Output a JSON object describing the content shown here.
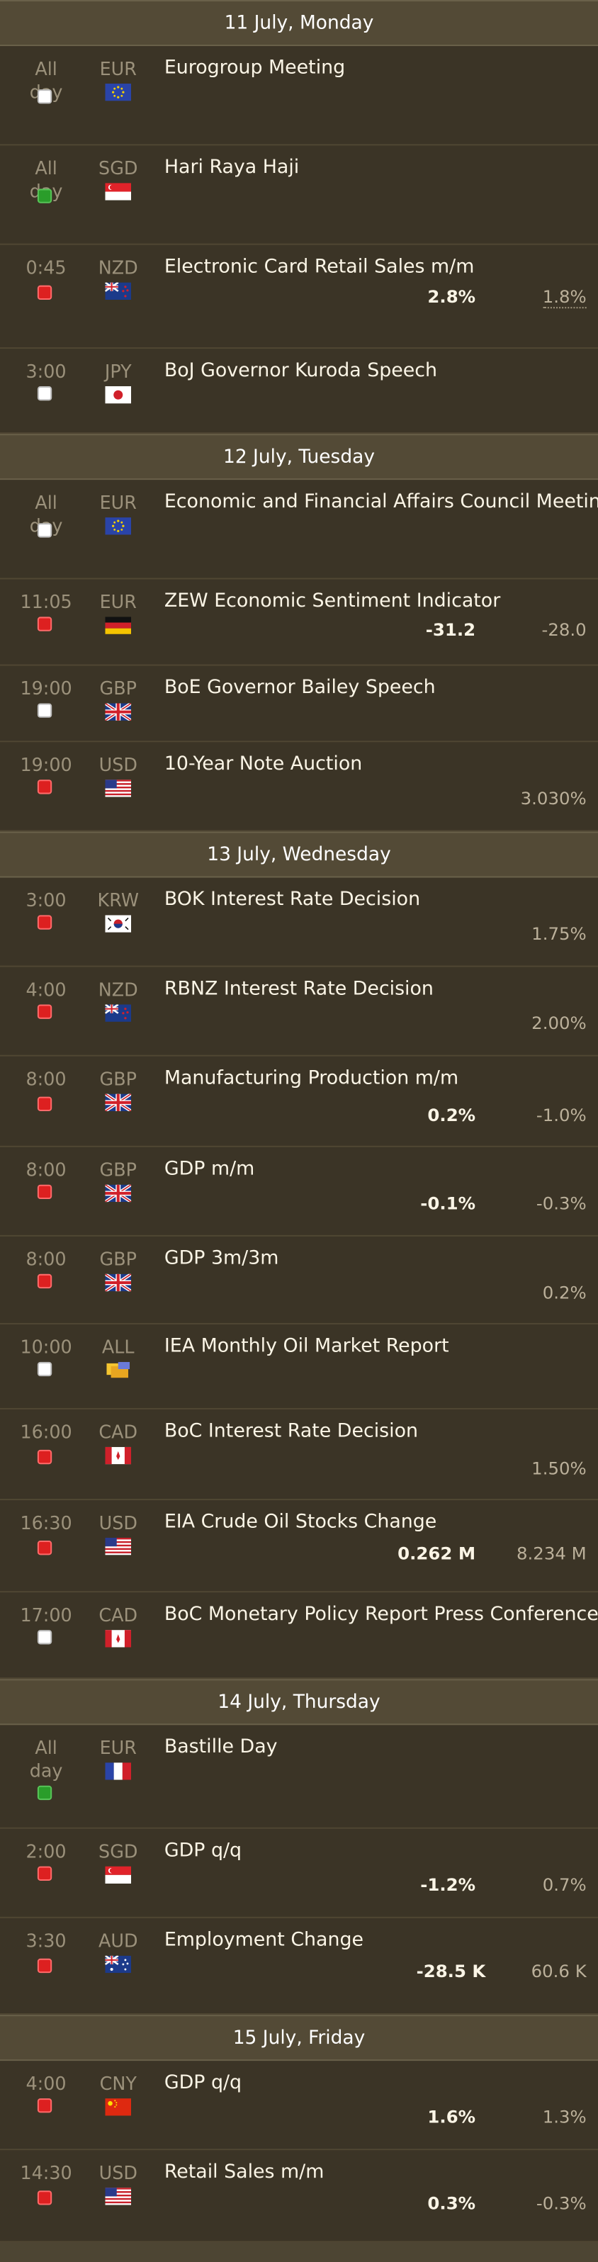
{
  "days": [
    {
      "title": "11 July, Monday",
      "events": [
        {
          "h": 69,
          "time": "All day",
          "cur": "EUR",
          "flag": "eu",
          "title": "Eurogroup Meeting",
          "chk": "w",
          "actual": "",
          "previous": ""
        },
        {
          "h": 69,
          "time": "All day",
          "cur": "SGD",
          "flag": "sg",
          "title": "Hari Raya Haji",
          "chk": "g",
          "actual": "",
          "previous": ""
        },
        {
          "h": 72,
          "time": "0:45",
          "cur": "NZD",
          "flag": "nz",
          "title": "Electronic Card Retail Sales m/m",
          "chk": "r",
          "actual": "2.8%",
          "previous": "1.8%",
          "prevDot": true
        },
        {
          "h": 59,
          "time": "3:00",
          "cur": "JPY",
          "flag": "jp",
          "title": "BoJ Governor Kuroda Speech",
          "chk": "w",
          "actual": "",
          "previous": ""
        }
      ]
    },
    {
      "title": "12 July, Tuesday",
      "events": [
        {
          "h": 69,
          "time": "All day",
          "cur": "EUR",
          "flag": "eu",
          "title": "Economic and Financial Affairs Council Meeting",
          "chk": "w",
          "actual": "",
          "previous": ""
        },
        {
          "h": 60,
          "time": "11:05",
          "cur": "EUR",
          "flag": "de",
          "title": "ZEW Economic Sentiment Indicator",
          "chk": "r",
          "actual": "-31.2",
          "previous": "-28.0"
        },
        {
          "h": 53,
          "time": "19:00",
          "cur": "GBP",
          "flag": "gb",
          "title": "BoE Governor Bailey Speech",
          "chk": "w",
          "actual": "",
          "previous": ""
        },
        {
          "h": 62,
          "time": "19:00",
          "cur": "USD",
          "flag": "us",
          "title": "10-Year Note Auction",
          "chk": "r",
          "actual": "",
          "previous": "3.030%"
        }
      ]
    },
    {
      "title": "13 July, Wednesday",
      "events": [
        {
          "h": 62,
          "time": "3:00",
          "cur": "KRW",
          "flag": "kr",
          "title": "BOK Interest Rate Decision",
          "chk": "r",
          "actual": "",
          "previous": "1.75%"
        },
        {
          "h": 62,
          "time": "4:00",
          "cur": "NZD",
          "flag": "nz",
          "title": "RBNZ Interest Rate Decision",
          "chk": "r",
          "actual": "",
          "previous": "2.00%"
        },
        {
          "h": 63,
          "time": "8:00",
          "cur": "GBP",
          "flag": "gb",
          "title": "Manufacturing Production m/m",
          "chk": "r",
          "actual": "0.2%",
          "previous": "-1.0%"
        },
        {
          "h": 62,
          "time": "8:00",
          "cur": "GBP",
          "flag": "gb",
          "title": "GDP m/m",
          "chk": "r",
          "actual": "-0.1%",
          "previous": "-0.3%"
        },
        {
          "h": 61,
          "time": "8:00",
          "cur": "GBP",
          "flag": "gb",
          "title": "GDP 3m/3m",
          "chk": "r",
          "actual": "",
          "previous": "0.2%"
        },
        {
          "h": 59,
          "time": "10:00",
          "cur": "ALL",
          "flag": "all",
          "title": "IEA Monthly Oil Market Report",
          "chk": "w",
          "actual": "",
          "previous": ""
        },
        {
          "h": 63,
          "time": "16:00",
          "cur": "CAD",
          "flag": "ca",
          "title": "BoC Interest Rate Decision",
          "chk": "r",
          "actual": "",
          "previous": "1.50%"
        },
        {
          "h": 64,
          "time": "16:30",
          "cur": "USD",
          "flag": "us",
          "title": "EIA Crude Oil Stocks Change",
          "chk": "r",
          "actual": "0.262 M",
          "previous": "8.234 M"
        },
        {
          "h": 60,
          "time": "17:00",
          "cur": "CAD",
          "flag": "ca",
          "title": "BoC Monetary Policy Report Press Conference",
          "chk": "w",
          "actual": "",
          "previous": ""
        }
      ]
    },
    {
      "title": "14 July, Thursday",
      "events": [
        {
          "h": 72,
          "time": "All day",
          "cur": "EUR",
          "flag": "fr",
          "title": "Bastille Day",
          "chk": "g",
          "actual": "",
          "previous": ""
        },
        {
          "h": 62,
          "time": "2:00",
          "cur": "SGD",
          "flag": "sg",
          "title": "GDP q/q",
          "chk": "r",
          "actual": "-1.2%",
          "previous": "0.7%"
        },
        {
          "h": 67,
          "time": "3:30",
          "cur": "AUD",
          "flag": "au",
          "title": "Employment Change",
          "chk": "r",
          "actual": "-28.5 K",
          "previous": "60.6 K",
          "actRight": 78
        }
      ]
    },
    {
      "title": "15 July, Friday",
      "events": [
        {
          "h": 62,
          "time": "4:00",
          "cur": "CNY",
          "flag": "cn",
          "title": "GDP q/q",
          "chk": "r",
          "actual": "1.6%",
          "previous": "1.3%"
        },
        {
          "h": 64,
          "time": "14:30",
          "cur": "USD",
          "flag": "us",
          "title": "Retail Sales m/m",
          "chk": "r",
          "actual": "0.3%",
          "previous": "-0.3%"
        }
      ]
    }
  ],
  "flags": {
    "eu": "EU flag",
    "sg": "Singapore flag",
    "nz": "New Zealand flag",
    "jp": "Japan flag",
    "de": "Germany flag",
    "gb": "United Kingdom flag",
    "us": "United States flag",
    "kr": "South Korea flag",
    "all": "all-currencies icon",
    "ca": "Canada flag",
    "fr": "France flag",
    "au": "Australia flag",
    "cn": "China flag"
  }
}
